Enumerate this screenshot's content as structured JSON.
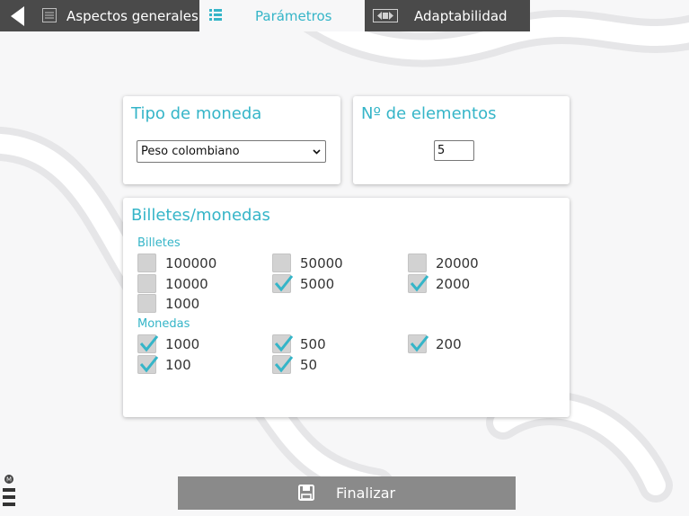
{
  "tabs": [
    {
      "label": "Aspectos generales",
      "icon": "list-icon",
      "active": false
    },
    {
      "label": "Parámetros",
      "icon": "list-icon",
      "active": true
    },
    {
      "label": "Adaptabilidad",
      "icon": "adapt-icon",
      "active": false
    }
  ],
  "tipo_moneda": {
    "title": "Tipo de moneda",
    "selected": "Peso colombiano"
  },
  "elementos": {
    "title": "Nº de elementos",
    "value": "5"
  },
  "billetes_monedas": {
    "title": "Billetes/monedas",
    "billetes_label": "Billetes",
    "billetes": [
      {
        "value": "100000",
        "checked": false
      },
      {
        "value": "50000",
        "checked": false
      },
      {
        "value": "20000",
        "checked": false
      },
      {
        "value": "10000",
        "checked": false
      },
      {
        "value": "5000",
        "checked": true
      },
      {
        "value": "2000",
        "checked": true
      },
      {
        "value": "1000",
        "checked": false
      }
    ],
    "monedas_label": "Monedas",
    "monedas": [
      {
        "value": "1000",
        "checked": true
      },
      {
        "value": "500",
        "checked": true
      },
      {
        "value": "200",
        "checked": true
      },
      {
        "value": "100",
        "checked": true
      },
      {
        "value": "50",
        "checked": true
      }
    ]
  },
  "finalizar": {
    "label": "Finalizar",
    "icon": "save-icon"
  },
  "colors": {
    "accent": "#35b5c8",
    "topbar": "#4a4a4a",
    "button": "#8a8a8a"
  }
}
